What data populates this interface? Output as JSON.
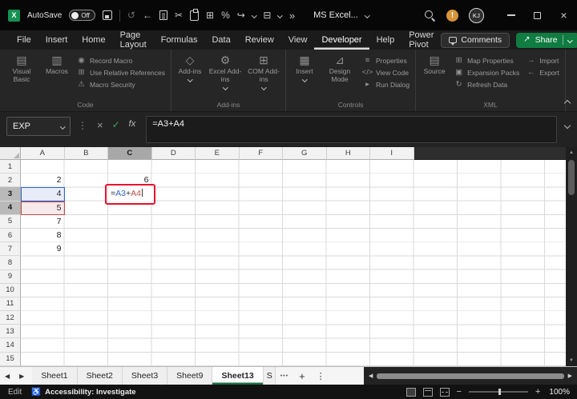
{
  "titlebar": {
    "autosave_label": "AutoSave",
    "autosave_state": "Off",
    "overflow_glyph": "»",
    "title": "MS Excel...",
    "user_initials": "KJ"
  },
  "menubar": {
    "items": [
      "File",
      "Insert",
      "Home",
      "Page Layout",
      "Formulas",
      "Data",
      "Review",
      "View",
      "Developer",
      "Help",
      "Power Pivot"
    ],
    "active_item": "Developer",
    "comments_label": "Comments",
    "share_label": "Share"
  },
  "ribbon": {
    "groups": [
      {
        "label": "Code",
        "big": [
          {
            "label": "Visual Basic",
            "icon": "visual-basic-icon",
            "glyph": "▤"
          },
          {
            "label": "Macros",
            "icon": "macros-icon",
            "glyph": "▥"
          }
        ],
        "small_cols": [
          [
            {
              "label": "Record Macro",
              "icon": "record-macro-icon",
              "glyph": "◉"
            },
            {
              "label": "Use Relative References",
              "icon": "relative-references-icon",
              "glyph": "⊞"
            },
            {
              "label": "Macro Security",
              "icon": "macro-security-icon",
              "glyph": "⚠"
            }
          ]
        ]
      },
      {
        "label": "Add-ins",
        "big": [
          {
            "label": "Add-ins",
            "icon": "addins-icon",
            "glyph": "◇",
            "dropdown": true
          },
          {
            "label": "Excel Add-ins",
            "icon": "excel-addins-icon",
            "glyph": "⚙",
            "dropdown": true
          },
          {
            "label": "COM Add-ins",
            "icon": "com-addins-icon",
            "glyph": "⊞",
            "dropdown": true
          }
        ],
        "small_cols": []
      },
      {
        "label": "Controls",
        "big": [
          {
            "label": "Insert",
            "icon": "insert-control-icon",
            "glyph": "▦",
            "dropdown": true
          },
          {
            "label": "Design Mode",
            "icon": "design-mode-icon",
            "glyph": "⊿"
          }
        ],
        "small_cols": [
          [
            {
              "label": "Properties",
              "icon": "properties-icon",
              "glyph": "≡"
            },
            {
              "label": "View Code",
              "icon": "view-code-icon",
              "glyph": "</>"
            },
            {
              "label": "Run Dialog",
              "icon": "run-dialog-icon",
              "glyph": "▸"
            }
          ]
        ]
      },
      {
        "label": "XML",
        "big": [
          {
            "label": "Source",
            "icon": "source-icon",
            "glyph": "▤"
          }
        ],
        "small_cols": [
          [
            {
              "label": "Map Properties",
              "icon": "map-properties-icon",
              "glyph": "⊞"
            },
            {
              "label": "Expansion Packs",
              "icon": "expansion-packs-icon",
              "glyph": "▣"
            },
            {
              "label": "Refresh Data",
              "icon": "refresh-data-icon",
              "glyph": "↻"
            }
          ],
          [
            {
              "label": "Import",
              "icon": "import-icon",
              "glyph": "→"
            },
            {
              "label": "Export",
              "icon": "export-icon",
              "glyph": "←"
            }
          ]
        ]
      }
    ]
  },
  "formula_bar": {
    "name_box_value": "EXP",
    "formula": "=A3+A4"
  },
  "grid": {
    "columns": [
      "A",
      "B",
      "C",
      "D",
      "E",
      "F",
      "G",
      "H",
      "I"
    ],
    "row_count": 15,
    "selected_column": "C",
    "selected_rows": [
      "3",
      "4"
    ],
    "cells": [
      {
        "col": "A",
        "row": 2,
        "value": "2"
      },
      {
        "col": "A",
        "row": 3,
        "value": "4"
      },
      {
        "col": "A",
        "row": 4,
        "value": "5"
      },
      {
        "col": "A",
        "row": 5,
        "value": "7"
      },
      {
        "col": "A",
        "row": 6,
        "value": "8"
      },
      {
        "col": "A",
        "row": 7,
        "value": "9"
      },
      {
        "col": "C",
        "row": 2,
        "value": "6"
      }
    ],
    "reference_boxes": [
      {
        "col": "A",
        "row": 3,
        "color": "#2e66c9",
        "fill": "rgba(46,102,201,0.12)"
      },
      {
        "col": "A",
        "row": 4,
        "color": "#be4b48",
        "fill": "rgba(190,75,72,0.12)"
      }
    ],
    "editing_cell": {
      "col": "C",
      "row": 3,
      "parts": [
        {
          "text": "=",
          "color": "#1f1f1f"
        },
        {
          "text": "A3",
          "color": "#2e66c9"
        },
        {
          "text": "+",
          "color": "#1f1f1f"
        },
        {
          "text": "A4",
          "color": "#be4b48"
        }
      ],
      "annotation_color": "#e8112d"
    }
  },
  "sheet_tabs": {
    "tabs": [
      "Sheet1",
      "Sheet2",
      "Sheet3",
      "Sheet9",
      "Sheet13",
      "S"
    ],
    "active_tab": "Sheet13",
    "overflow_dots": "•••",
    "add_label": "+"
  },
  "status_bar": {
    "mode": "Edit",
    "accessibility_text": "Accessibility: Investigate",
    "zoom": "100%"
  },
  "icons": {
    "undo": "↺",
    "back": "←",
    "cut": "✂",
    "borders": "⊞",
    "percent": "%",
    "redo": "↪",
    "table": "⊟",
    "dots_vertical": "⋮",
    "cancel": "×",
    "enter": "✓",
    "fx": "fx",
    "scroll_up": "▲",
    "scroll_down": "▼",
    "tab_left": "◀",
    "tab_right": "▶",
    "kebab": "⋮",
    "share_arrow": "↗",
    "accessibility": "♿",
    "zoom_out": "−",
    "zoom_in": "+",
    "close": "×",
    "logo_letter": "X",
    "warning": "!"
  },
  "colors": {
    "accent_green": "#107c41",
    "annotation_red": "#e8112d",
    "reference_blue": "#2e66c9",
    "reference_red": "#be4b48"
  }
}
